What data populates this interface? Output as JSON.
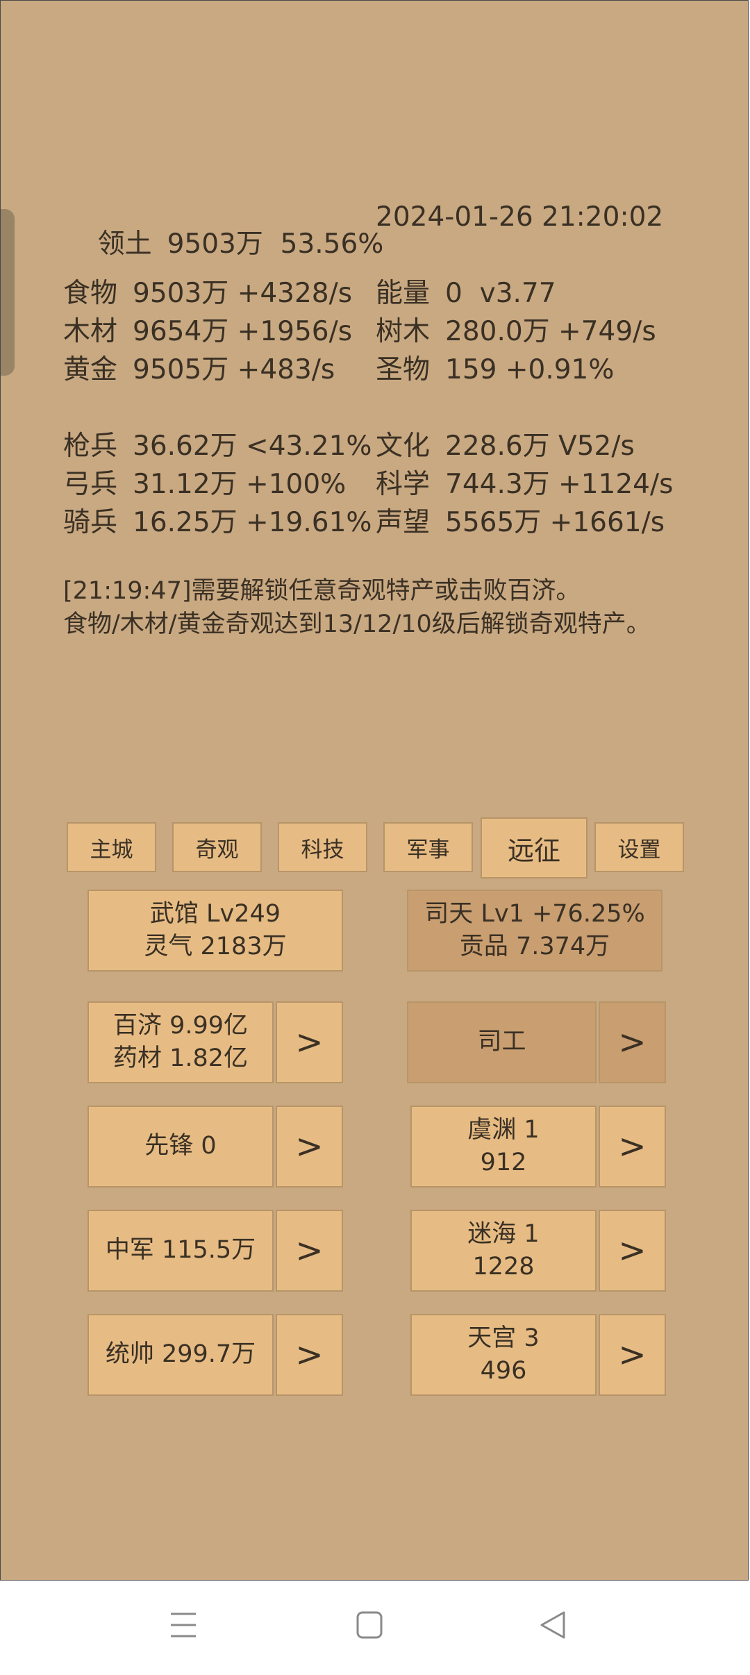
{
  "stats": {
    "territory": {
      "label": "领土",
      "values": "9503万  53.56%"
    },
    "datetime": "2024-01-26 21:20:02",
    "left": [
      {
        "label": "食物",
        "value": "9503万 +4328/s"
      },
      {
        "label": "木材",
        "value": "9654万 +1956/s"
      },
      {
        "label": "黄金",
        "value": "9505万 +483/s"
      },
      {
        "label": "枪兵",
        "value": "36.62万 <43.21%"
      },
      {
        "label": "弓兵",
        "value": "31.12万 +100%"
      },
      {
        "label": "骑兵",
        "value": "16.25万 +19.61%"
      }
    ],
    "right": [
      {
        "label": "能量",
        "value": "0  v3.77"
      },
      {
        "label": "树木",
        "value": "280.0万 +749/s"
      },
      {
        "label": "圣物",
        "value": "159 +0.91%"
      },
      {
        "label": "文化",
        "value": "228.6万 V52/s"
      },
      {
        "label": "科学",
        "value": "744.3万 +1124/s"
      },
      {
        "label": "声望",
        "value": "5565万 +1661/s"
      }
    ]
  },
  "messages": {
    "line1": "[21:19:47]需要解锁任意奇观特产或击败百济。",
    "line2": "食物/木材/黄金奇观达到13/12/10级后解锁奇观特产。"
  },
  "tabs": [
    "主城",
    "奇观",
    "科技",
    "军事",
    "远征",
    "设置"
  ],
  "active_tab": "远征",
  "panel": {
    "wuguan": {
      "line1": "武馆 Lv249",
      "line2": "灵气 2183万"
    },
    "sitian": {
      "line1": "司天 Lv1 +76.25%",
      "line2": "贡品 7.374万"
    },
    "baiji": {
      "line1": "百济  9.99亿",
      "line2": "药材 1.82亿"
    },
    "sigong": {
      "line1": "司工"
    },
    "xianfeng": {
      "line1": "先锋  0"
    },
    "zhongjun": {
      "line1": "中军  115.5万"
    },
    "tongshuai": {
      "line1": "统帅  299.7万"
    },
    "yuyuan": {
      "line1": "虞渊  1",
      "line2": "912"
    },
    "mihai": {
      "line1": "迷海  1",
      "line2": "1228"
    },
    "tiangong": {
      "line1": "天宫  3",
      "line2": "496"
    },
    "arrow": ">"
  },
  "icons": {
    "menu": "menu-icon",
    "home": "home-square-icon",
    "back": "back-triangle-icon"
  },
  "colors": {
    "background": "#c9a982",
    "button": "#e7bc84",
    "button_dark": "#c99e70",
    "text": "#3a3024"
  }
}
